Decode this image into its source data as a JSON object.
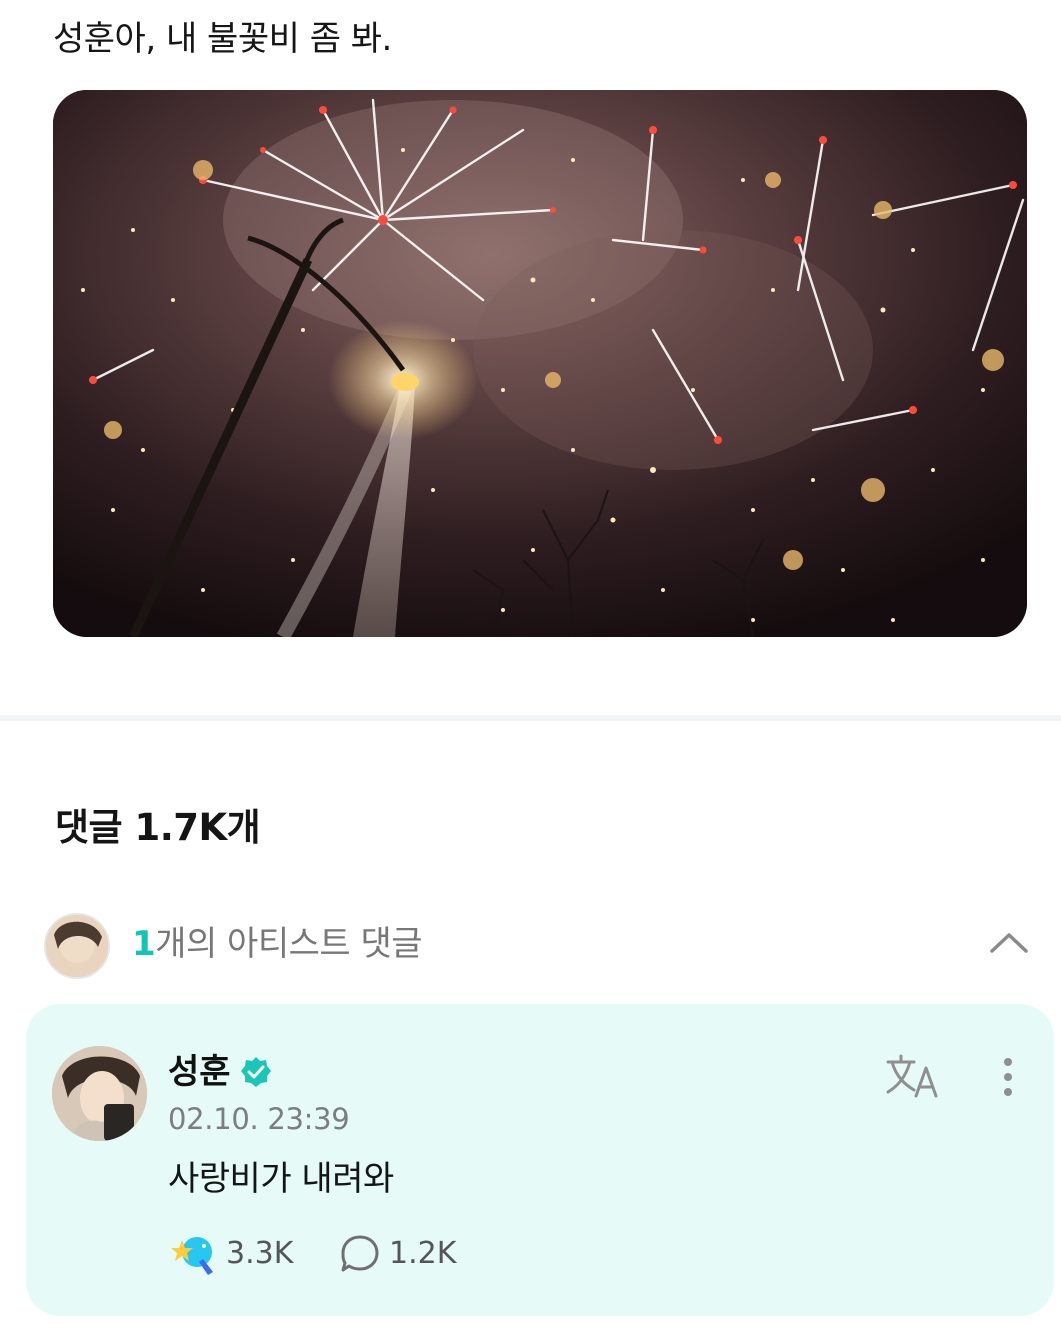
{
  "post": {
    "text": "성훈아, 내 불꽃비 좀 봐.",
    "image_alt": "fireworks photo"
  },
  "comments": {
    "header": "댓글 1.7K개",
    "artist_summary": {
      "count": "1",
      "label": "개의 아티스트 댓글"
    }
  },
  "artist_comment": {
    "author": "성훈",
    "timestamp": "02.10. 23:39",
    "body": "사랑비가 내려와",
    "likes": "3.3K",
    "replies": "1.2K"
  },
  "icons": {
    "collapse": "chevron-up-icon",
    "verified": "verified-badge-icon",
    "translate": "translate-icon",
    "more": "more-vertical-icon",
    "like": "star-wand-icon",
    "reply": "speech-bubble-icon"
  },
  "colors": {
    "accent": "#14c3b3",
    "card_background": "#e6fbf7",
    "verified": "#19c6b8"
  }
}
